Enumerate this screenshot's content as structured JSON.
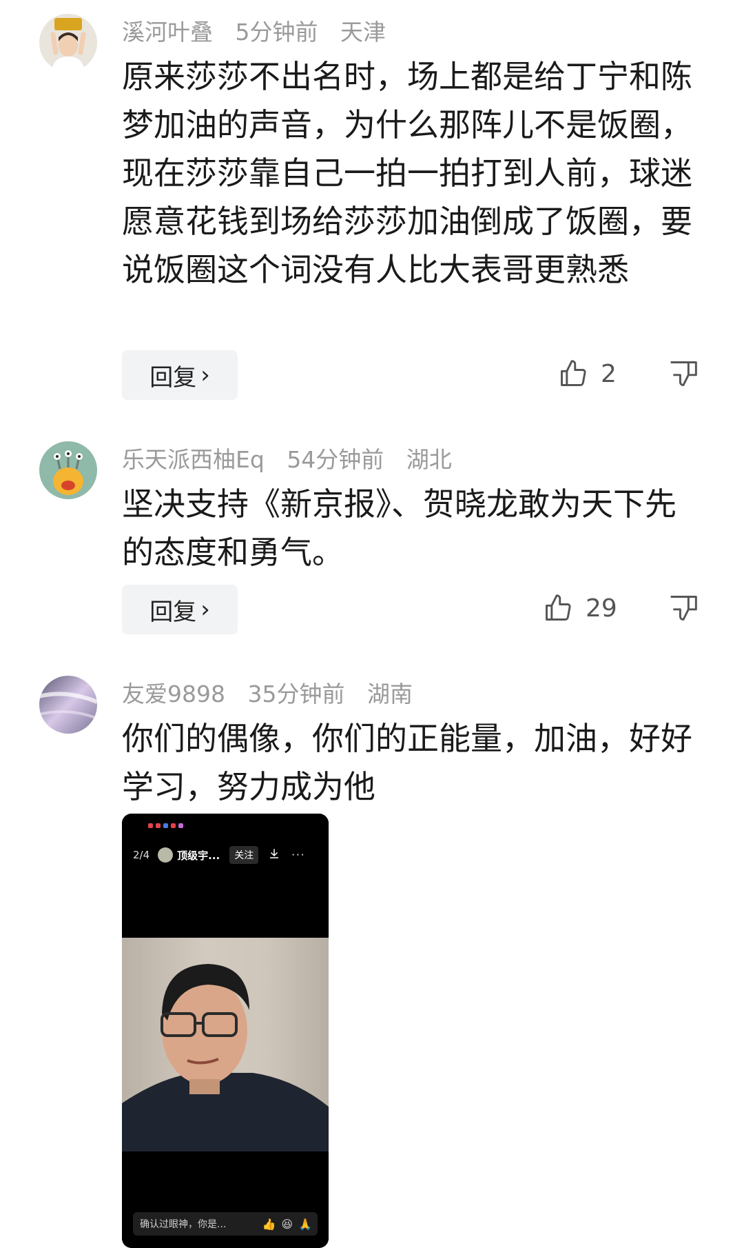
{
  "comments": [
    {
      "username": "溪河叶叠",
      "time": "5分钟前",
      "location": "天津",
      "text": "原来莎莎不出名时，场上都是给丁宁和陈梦加油的声音，为什么那阵儿不是饭圈，现在莎莎靠自己一拍一拍打到人前，球迷愿意花钱到场给莎莎加油倒成了饭圈，要说饭圈这个词没有人比大表哥更熟悉",
      "reply_label": "回复",
      "likes": "2"
    },
    {
      "username": "乐天派西柚Eq",
      "time": "54分钟前",
      "location": "湖北",
      "text": "坚决支持《新京报》、贺晓龙敢为天下先的态度和勇气。",
      "reply_label": "回复",
      "likes": "29"
    },
    {
      "username": "友爱9898",
      "time": "35分钟前",
      "location": "湖南",
      "text": "你们的偶像，你们的正能量，加油，好好学习，努力成为他",
      "attachment": {
        "page_indicator": "2/4",
        "account_name": "顶级宇...",
        "follow_label": "关注",
        "more_glyph": "···",
        "comment_placeholder": "确认过眼神，你是..."
      }
    }
  ],
  "icons": {
    "like": "thumbs-up-icon",
    "dislike": "thumbs-down-icon",
    "chevron": "›"
  },
  "colors": {
    "meta_gray": "#9a9a9a",
    "reply_bg": "#f2f3f5",
    "text": "#1a1a1a"
  }
}
